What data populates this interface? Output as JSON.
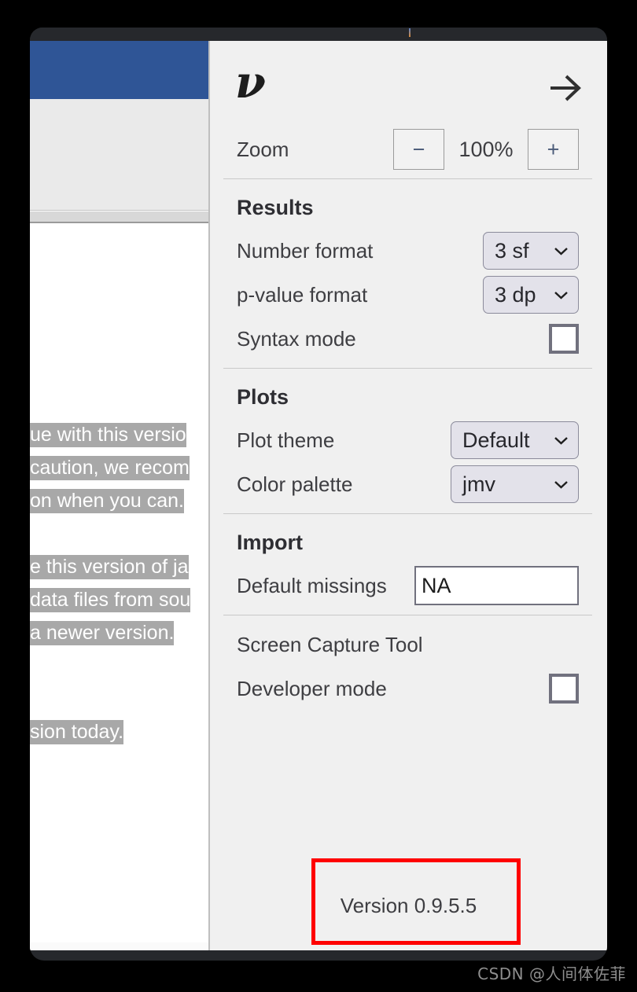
{
  "window": {
    "title_bar_name": "jamovi-window-title-bar"
  },
  "document": {
    "lines": [
      "ue with this versio",
      "caution, we recom",
      "on when you can.",
      "",
      "e this version of ja",
      "data files from sou",
      " a newer version.",
      "",
      "sion today."
    ]
  },
  "settings": {
    "logo_glyph": "ν",
    "back_arrow_name": "right-arrow-icon",
    "zoom": {
      "label": "Zoom",
      "decrease_label": "−",
      "value": "100%",
      "increase_label": "+"
    },
    "results": {
      "title": "Results",
      "number_format": {
        "label": "Number format",
        "value": "3 sf"
      },
      "pvalue_format": {
        "label": "p-value format",
        "value": "3 dp"
      },
      "syntax_mode": {
        "label": "Syntax mode",
        "checked": false
      }
    },
    "plots": {
      "title": "Plots",
      "plot_theme": {
        "label": "Plot theme",
        "value": "Default"
      },
      "color_palette": {
        "label": "Color palette",
        "value": "jmv"
      }
    },
    "import": {
      "title": "Import",
      "default_missings": {
        "label": "Default missings",
        "value": "NA"
      }
    },
    "tools": {
      "screen_capture_label": "Screen Capture Tool",
      "developer_mode": {
        "label": "Developer mode",
        "checked": false
      }
    },
    "version_label": "Version 0.9.5.5"
  },
  "annotation": {
    "color": "#fe0000",
    "target": "version-label"
  },
  "watermark": {
    "text": "CSDN @人间体佐菲"
  },
  "colors": {
    "ribbon_blue": "#2f5596",
    "panel_bg": "#f0f0f0",
    "window_chrome": "#26282c",
    "dropdown_bg": "#e3e2ea",
    "annotation_red": "#fe0000"
  }
}
